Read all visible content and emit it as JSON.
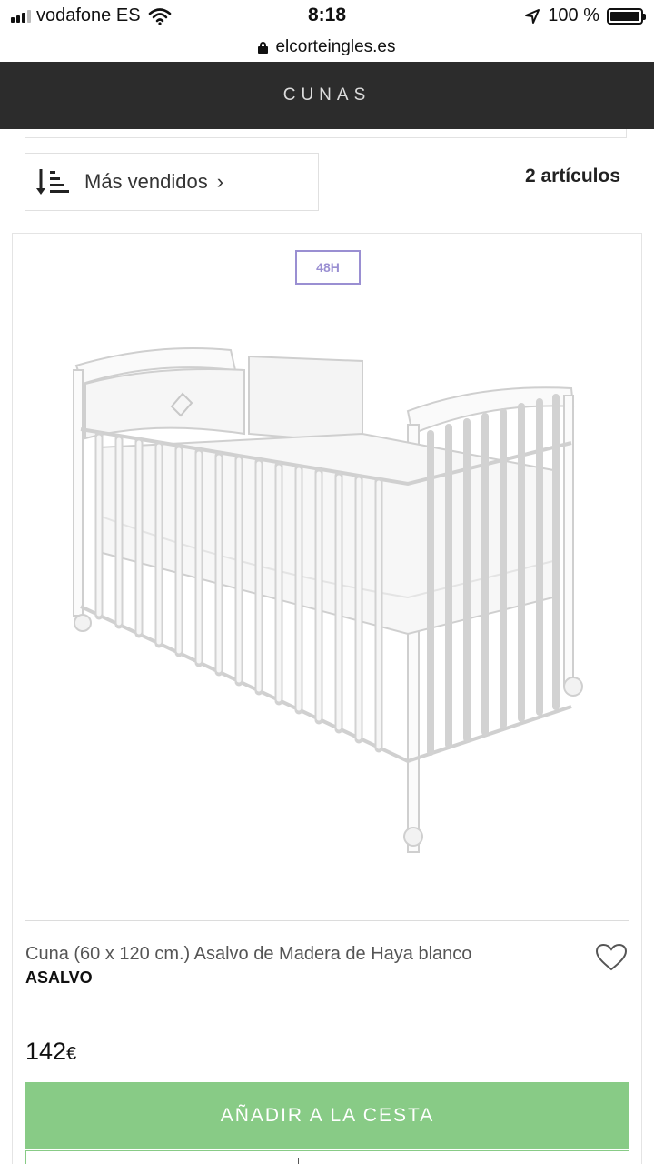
{
  "status_bar": {
    "carrier": "vodafone ES",
    "time": "8:18",
    "battery_percent": "100 %",
    "battery_level": 1.0
  },
  "browser": {
    "url": "elcorteingles.es"
  },
  "header": {
    "title": "CUNAS"
  },
  "toolbar": {
    "sort_label": "Más vendidos",
    "sort_chevron": "›",
    "results_count": "2 artículos"
  },
  "product": {
    "badge": "48H",
    "name": "Cuna (60 x 120 cm.) Asalvo de Madera de Haya blanco",
    "brand": "ASALVO",
    "price_value": "142",
    "price_currency": "€",
    "add_to_cart_label": "AÑADIR A LA CESTA",
    "image": "white wooden baby crib",
    "favorite_icon": "heart-icon"
  },
  "colors": {
    "header_bg": "#2c2c2c",
    "add_button": "#88cb86",
    "badge": "#9a8fd2"
  }
}
